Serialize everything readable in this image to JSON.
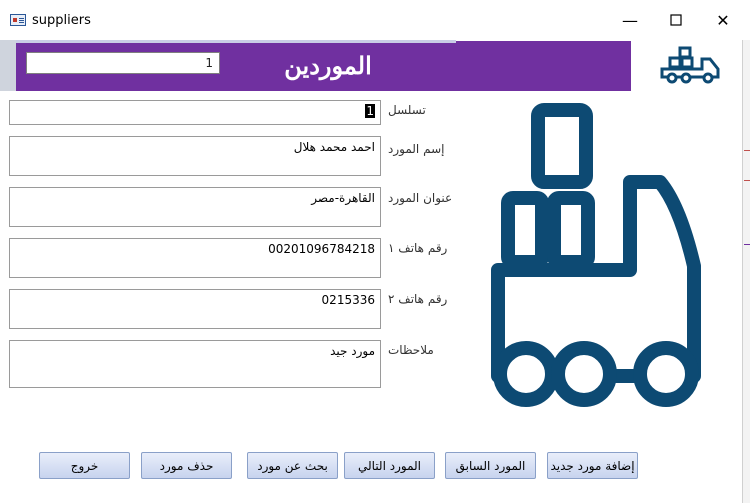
{
  "window": {
    "title": "suppliers",
    "minimize_glyph": "—",
    "maximize_glyph": "☐",
    "close_glyph": "✕"
  },
  "header": {
    "title": "الموردين",
    "record_number": "1"
  },
  "fields": [
    {
      "label": "تسلسل",
      "value": "1"
    },
    {
      "label": "إسم المورد",
      "value": "احمد محمد هلال"
    },
    {
      "label": "عنوان المورد",
      "value": "القاهرة-مصر"
    },
    {
      "label": "رقم هاتف ١",
      "value": "00201096784218"
    },
    {
      "label": "رقم هاتف ٢",
      "value": "0215336"
    },
    {
      "label": "ملاحظات",
      "value": "مورد جيد"
    }
  ],
  "buttons": {
    "add": "إضافة مورد جديد",
    "previous": "المورد السابق",
    "next": "المورد التالي",
    "search": "بحث عن مورد",
    "delete": "حذف مورد",
    "exit": "خروج"
  },
  "icons": {
    "app": "access-form-icon",
    "logo_small": "truck-icon",
    "logo_big": "truck-icon"
  },
  "colors": {
    "header_band": "#7030a0",
    "truck": "#0d4a73",
    "button_top": "#e9eefa",
    "button_bottom": "#c7d3ee"
  }
}
